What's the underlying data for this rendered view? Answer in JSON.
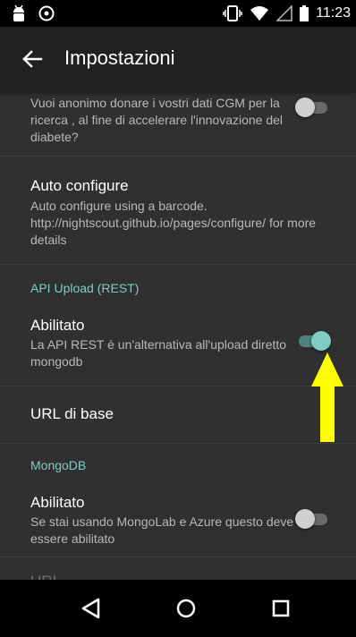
{
  "status_bar": {
    "time": "11:23",
    "left_icons": [
      "android-debug-icon",
      "sync-icon"
    ],
    "right_icons": [
      "vibrate-icon",
      "wifi-icon",
      "signal-icon",
      "battery-icon"
    ]
  },
  "app_bar": {
    "title": "Impostazioni",
    "back_icon": "arrow-left-icon"
  },
  "preferences": {
    "donate": {
      "summary": "Vuoi anonimo donare i vostri dati CGM per la ricerca , al fine di accelerare l'innovazione del diabete?",
      "enabled": false
    },
    "auto_configure": {
      "title": "Auto configure",
      "summary": "Auto configure using a barcode. http://nightscout.github.io/pages/configure/ for more details"
    },
    "api_category": "API Upload (REST)",
    "api_enabled": {
      "title": "Abilitato",
      "summary": "La API REST è un'alternativa all'upload diretto mongodb",
      "enabled": true
    },
    "base_url": {
      "title": "URL di base"
    },
    "mongo_category": "MongoDB",
    "mongo_enabled": {
      "title": "Abilitato",
      "summary": "Se stai usando MongoLab e Azure questo deve essere abilitato",
      "enabled": false
    },
    "uri_partial": {
      "title": "URI"
    }
  },
  "annotation": {
    "arrow_color": "#ffff00"
  },
  "colors": {
    "accent": "#80cbc4",
    "background": "#303030",
    "appbar": "#212121"
  },
  "nav_bar": {
    "buttons": [
      "back-triangle-icon",
      "home-circle-icon",
      "recents-square-icon"
    ]
  }
}
